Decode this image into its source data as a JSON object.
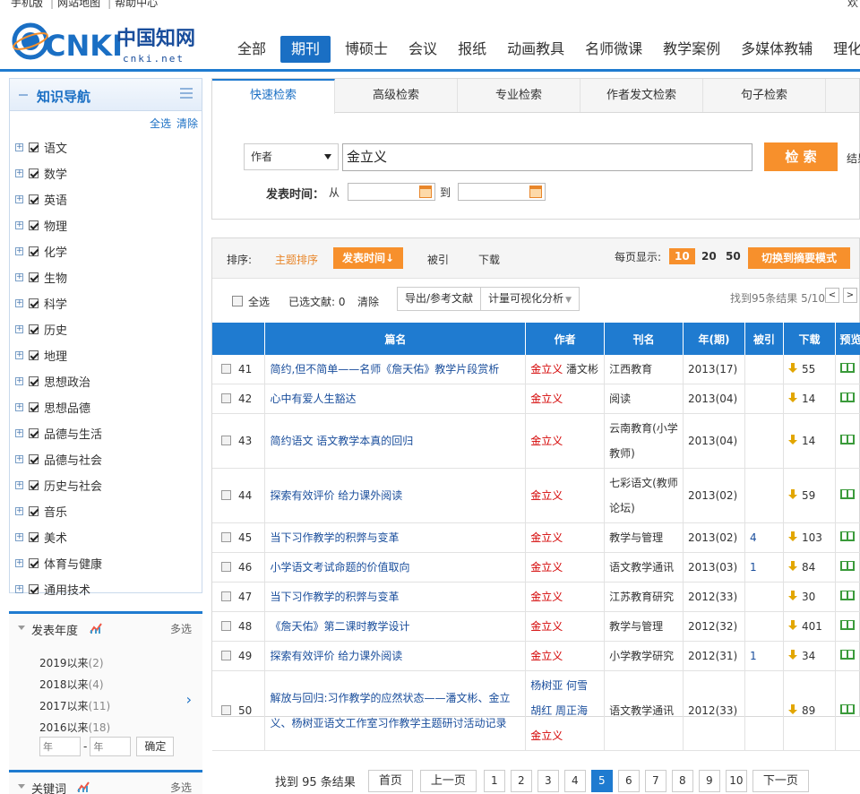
{
  "top": {
    "links": [
      "手机版",
      "网站地图",
      "帮助中心"
    ],
    "right": "欢"
  },
  "header": {
    "logo_text": "CNKI",
    "logo_cn": "中国知网",
    "logo_url": "cnki.net",
    "nav": [
      "全部",
      "期刊",
      "博硕士",
      "会议",
      "报纸",
      "动画教具",
      "名师微课",
      "教学案例",
      "多媒体教辅",
      "理化生"
    ],
    "active_nav": 1
  },
  "sidebar": {
    "title": "知识导航",
    "select_all": "全选",
    "clear": "清除",
    "subjects": [
      "语文",
      "数学",
      "英语",
      "物理",
      "化学",
      "生物",
      "科学",
      "历史",
      "地理",
      "思想政治",
      "思想品德",
      "品德与生活",
      "品德与社会",
      "历史与社会",
      "音乐",
      "美术",
      "体育与健康",
      "通用技术"
    ],
    "year_section": {
      "title": "发表年度",
      "more": "多选",
      "years": [
        {
          "label": "2019以来",
          "count": "(2)"
        },
        {
          "label": "2018以来",
          "count": "(4)"
        },
        {
          "label": "2017以来",
          "count": "(11)"
        },
        {
          "label": "2016以来",
          "count": "(18)"
        }
      ],
      "from_placeholder": "年",
      "to_placeholder": "年",
      "confirm": "确定"
    },
    "keyword_section": {
      "title": "关键词",
      "more": "多选"
    }
  },
  "search": {
    "tabs": [
      "快速检索",
      "高级检索",
      "专业检索",
      "作者发文检索",
      "句子检索"
    ],
    "active_tab": 0,
    "field": "作者",
    "value": "金立义",
    "button": "检 索",
    "result_search": "结果",
    "date_label": "发表时间：",
    "from": "从",
    "to": "到"
  },
  "sortbar": {
    "label": "排序:",
    "options": [
      "主题排序",
      "发表时间↓",
      "被引",
      "下载"
    ],
    "per_page_label": "每页显示:",
    "per_page": [
      "10",
      "20",
      "50"
    ],
    "switch": "切换到摘要模式"
  },
  "toolbar": {
    "select_all": "全选",
    "selected": "已选文献:  0",
    "clear": "清除",
    "export": "导出/参考文献",
    "visualize": "计量可视化分析",
    "found": "找到95条结果 5/10",
    "prev": "<",
    "next": ">"
  },
  "table": {
    "headers": [
      "篇名",
      "作者",
      "刊名",
      "年(期)",
      "被引",
      "下载",
      "预览"
    ],
    "rows": [
      {
        "n": "41",
        "title": "简约,但不简单——名师《詹天佑》教学片段赏析",
        "author_red": "金立义",
        "author_rest": " 潘文彬",
        "journal": "江西教育",
        "year": "2013(17)",
        "cite": "",
        "dl": "55"
      },
      {
        "n": "42",
        "title": "心中有爱人生豁达",
        "author_red": "金立义",
        "author_rest": "",
        "journal": "阅读",
        "year": "2013(04)",
        "cite": "",
        "dl": "14"
      },
      {
        "n": "43",
        "title": "简约语文 语文教学本真的回归",
        "author_red": "金立义",
        "author_rest": "",
        "journal": "云南教育(小学教师)",
        "year": "2013(04)",
        "cite": "",
        "dl": "14"
      },
      {
        "n": "44",
        "title": "探索有效评价 给力课外阅读",
        "author_red": "金立义",
        "author_rest": "",
        "journal": "七彩语文(教师论坛)",
        "year": "2013(02)",
        "cite": "",
        "dl": "59"
      },
      {
        "n": "45",
        "title": "当下习作教学的积弊与变革",
        "author_red": "金立义",
        "author_rest": "",
        "journal": "教学与管理",
        "year": "2013(02)",
        "cite": "4",
        "dl": "103"
      },
      {
        "n": "46",
        "title": "小学语文考试命题的价值取向",
        "author_red": "金立义",
        "author_rest": "",
        "journal": "语文教学通讯",
        "year": "2013(03)",
        "cite": "1",
        "dl": "84"
      },
      {
        "n": "47",
        "title": "当下习作教学的积弊与变革",
        "author_red": "金立义",
        "author_rest": "",
        "journal": "江苏教育研究",
        "year": "2012(33)",
        "cite": "",
        "dl": "30"
      },
      {
        "n": "48",
        "title": "《詹天佑》第二课时教学设计",
        "author_red": "金立义",
        "author_rest": "",
        "journal": "教学与管理",
        "year": "2012(32)",
        "cite": "",
        "dl": "401"
      },
      {
        "n": "49",
        "title": "探索有效评价 给力课外阅读",
        "author_red": "金立义",
        "author_rest": "",
        "journal": "小学教学研究",
        "year": "2012(31)",
        "cite": "1",
        "dl": "34"
      },
      {
        "n": "50",
        "title": "解放与回归:习作教学的应然状态——潘文彬、金立义、杨树亚语文工作室习作教学主题研讨活动记录",
        "author_pre": "杨树亚 何雪 胡红 周正海 ",
        "author_red": "金立义",
        "author_rest": "",
        "journal": "语文教学通讯",
        "year": "2012(33)",
        "cite": "",
        "dl": "89"
      }
    ]
  },
  "pagination": {
    "found": "找到 95 条结果",
    "first": "首页",
    "prev": "上一页",
    "pages": [
      "1",
      "2",
      "3",
      "4",
      "5",
      "6",
      "7",
      "8",
      "9",
      "10"
    ],
    "active": "5",
    "next": "下一页"
  },
  "colors": {
    "brand_blue": "#1f7bd0",
    "accent_orange": "#f7902c",
    "author_red": "#d40000"
  }
}
